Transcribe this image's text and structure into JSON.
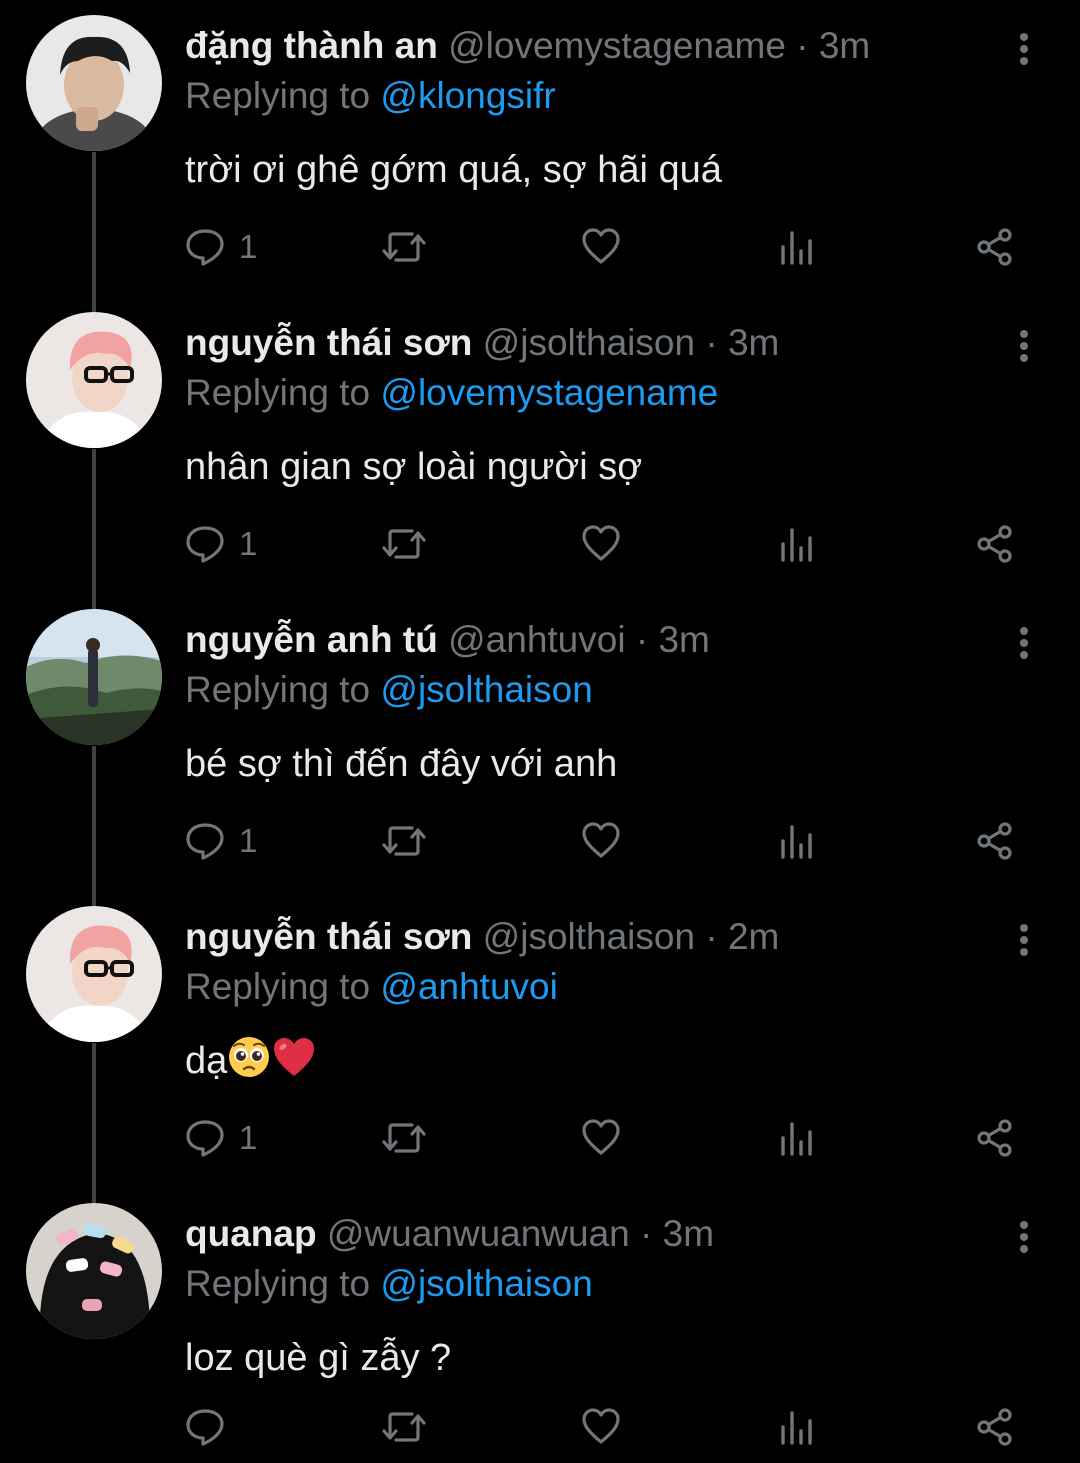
{
  "theme": {
    "background": "#000000",
    "text": "#e7e9ea",
    "muted": "#71767b",
    "link": "#1d9bf0",
    "thread_line": "#3e4144"
  },
  "tweets": [
    {
      "display_name": "đặng thành an",
      "handle": "@lovemystagename",
      "dot": "·",
      "time": "3m",
      "replying_prefix": "Replying to",
      "replying_to": "@klongsifr",
      "text": "trời ơi ghê gớm quá, sợ hãi quá",
      "reply_count": "1",
      "avatar_icon": "avatar-man-dark-hair"
    },
    {
      "display_name": "nguyễn thái sơn",
      "handle": "@jsolthaison",
      "dot": "·",
      "time": "3m",
      "replying_prefix": "Replying to",
      "replying_to": "@lovemystagename",
      "text": "nhân gian sợ loài người sợ",
      "reply_count": "1",
      "avatar_icon": "avatar-man-pink-hair-glasses"
    },
    {
      "display_name": "nguyễn anh tú",
      "handle": "@anhtuvoi",
      "dot": "·",
      "time": "3m",
      "replying_prefix": "Replying to",
      "replying_to": "@jsolthaison",
      "text": "bé sợ thì đến đây với anh",
      "reply_count": "1",
      "avatar_icon": "avatar-landscape-person"
    },
    {
      "display_name": "nguyễn thái sơn",
      "handle": "@jsolthaison",
      "dot": "·",
      "time": "2m",
      "replying_prefix": "Replying to",
      "replying_to": "@anhtuvoi",
      "text": "dạ",
      "emojis": [
        "pleading-face-emoji",
        "red-heart-emoji"
      ],
      "reply_count": "1",
      "avatar_icon": "avatar-man-pink-hair-glasses"
    },
    {
      "display_name": "quanap",
      "handle": "@wuanwuanwuan",
      "dot": "·",
      "time": "3m",
      "replying_prefix": "Replying to",
      "replying_to": "@jsolthaison",
      "text": "loz què gì zẫy ?",
      "reply_count": "",
      "avatar_icon": "avatar-hair-clips"
    }
  ]
}
